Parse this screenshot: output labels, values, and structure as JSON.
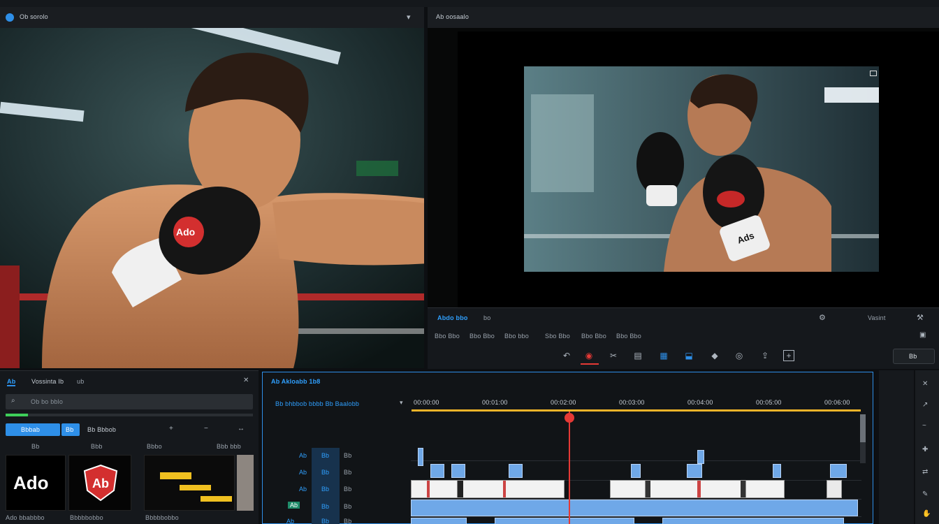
{
  "source_panel": {
    "title": "Ob sorolo",
    "status": "Ado"
  },
  "program_panel": {
    "title": "Ab oosaalo",
    "overlay_badge": "Ads"
  },
  "program_footer": {
    "left_label": "Abdo bbo",
    "left_code": "bo",
    "right_status": "Vasint",
    "row2": [
      "Bbo Bbo",
      "Bbo Bbo",
      "Bbo bbo",
      "Sbo Bbo",
      "Bbo Bbo",
      "Bbo Bbo"
    ],
    "right_button": "Bb"
  },
  "project_panel": {
    "tab_label": "Ab",
    "title": "Vossinta Ib",
    "subtitle": "ub",
    "search_placeholder": "Ob bo bblo",
    "primary_button": "Bbbab",
    "secondary_button": "Bb",
    "third_label": "Bb Bbbob",
    "col_headers": [
      "Bb",
      "Bbb",
      "Bbbo",
      "Bbb bbb"
    ],
    "thumbs": [
      {
        "label": "Ado",
        "caption": "Ado bbabbbo"
      },
      {
        "label": "Ab",
        "caption": "Bbbbbobbo"
      },
      {
        "label": "",
        "caption": "Bbbbbobbo"
      }
    ]
  },
  "timeline_panel": {
    "title": "Ab Akloabb 1b8",
    "subtitle": "Bb bhbbob bbbb Bb Baalobb",
    "timecodes": [
      "00:00:00",
      "00:01:00",
      "00:02:00",
      "00:03:00",
      "00:04:00",
      "00:05:00",
      "00:06:00"
    ],
    "tracks": [
      {
        "label": "Ab",
        "lock": "Bb",
        "name": "Bb"
      },
      {
        "label": "Ab",
        "lock": "Bb",
        "name": "Bb"
      },
      {
        "label": "Ab",
        "lock": "Bb",
        "name": "Bb"
      },
      {
        "label": "Ab",
        "lock": "Bb",
        "name": "Bb"
      },
      {
        "label": "Ab",
        "lock": "Bb",
        "name": "Bb"
      }
    ]
  },
  "colors": {
    "accent": "#2e8fe8",
    "playhead": "#e53935",
    "work_area": "#f0b429",
    "clip": "#6fa8e8"
  }
}
